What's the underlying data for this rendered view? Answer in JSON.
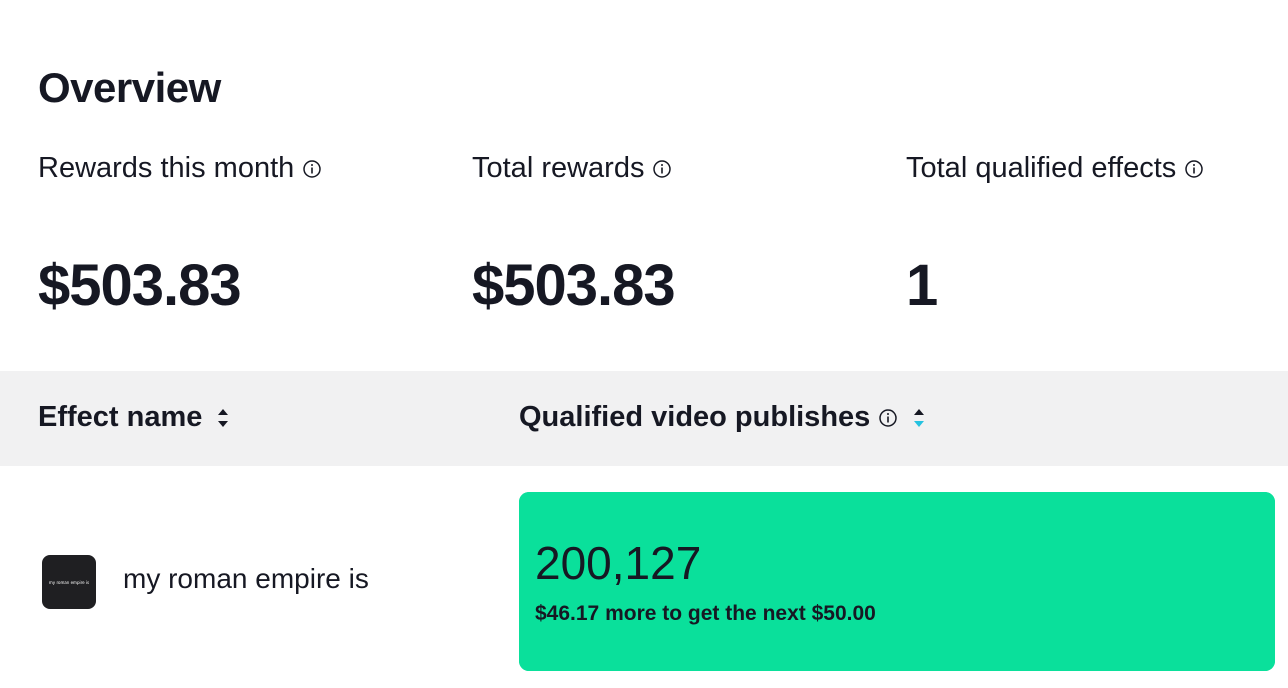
{
  "overview": {
    "title": "Overview",
    "stats": [
      {
        "label": "Rewards this month",
        "value": "$503.83"
      },
      {
        "label": "Total rewards",
        "value": "$503.83"
      },
      {
        "label": "Total qualified effects",
        "value": "1"
      }
    ]
  },
  "table": {
    "columns": [
      {
        "label": "Effect name",
        "sort_icon": "sort-icon"
      },
      {
        "label": "Qualified video publishes",
        "info_icon": "info-icon",
        "sort_icon": "sort-icon"
      }
    ],
    "rows": [
      {
        "thumbnail_text": "my roman empire is",
        "effect_name": "my roman empire is",
        "publishes": "200,127",
        "progress_note": "$46.17 more to get the next $50.00",
        "progress_fraction": 1.0
      }
    ]
  },
  "colors": {
    "progress": "#0ae09b",
    "header_bg": "#f1f1f2",
    "sort_active": "#25c2e0",
    "text": "#161823"
  }
}
